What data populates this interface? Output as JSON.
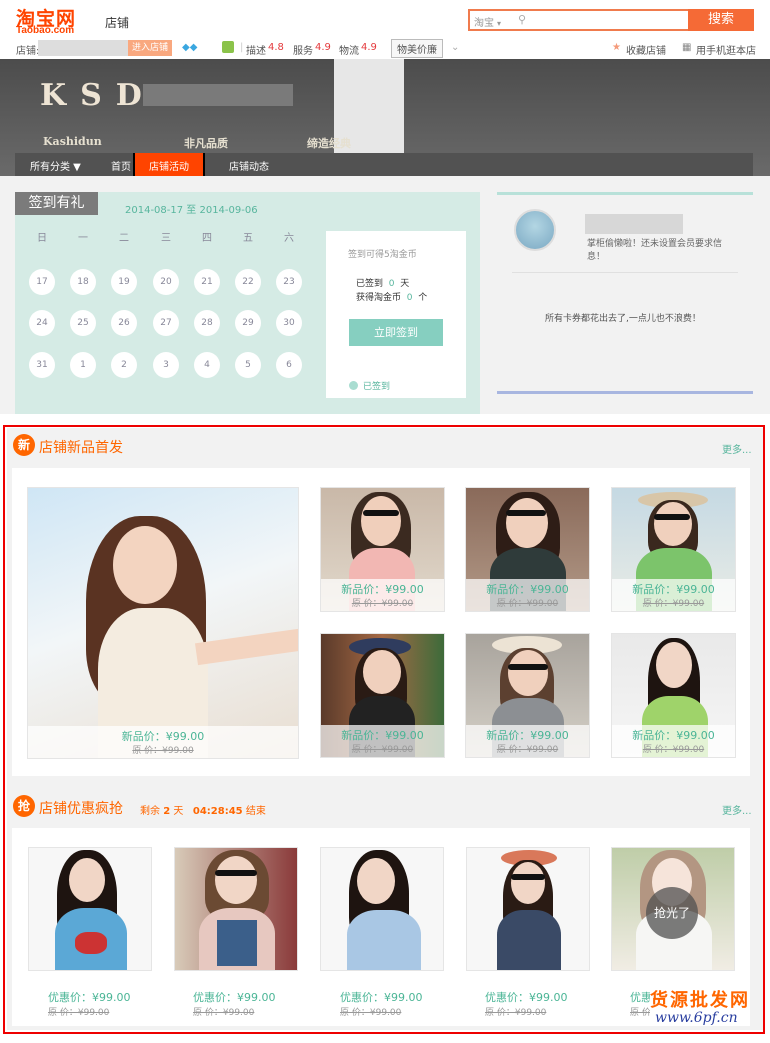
{
  "header": {
    "logo_cn": "淘宝网",
    "logo_en": "Taobao.com",
    "shop_tab": "店铺",
    "search_scope": "淘宝",
    "search_button": "搜索"
  },
  "infobar": {
    "shop_label": "店铺:",
    "enter_shop": "进入店铺",
    "desc_label": "描述",
    "desc_score": "4.8",
    "service_label": "服务",
    "service_score": "4.9",
    "logistics_label": "物流",
    "logistics_score": "4.9",
    "value_button": "物美价廉",
    "favorite": "收藏店铺",
    "mobile": "用手机逛本店"
  },
  "banner": {
    "brand": "KSD",
    "tag1": "Kashidun",
    "tag2": "非凡品质",
    "tag3": "缔造经典"
  },
  "nav": {
    "items": [
      "所有分类 ▼",
      "首页",
      "店铺活动",
      "店铺动态"
    ]
  },
  "checkin": {
    "title": "签到有礼",
    "date_range": "2014-08-17 至 2014-09-06",
    "weekdays": [
      "日",
      "一",
      "二",
      "三",
      "四",
      "五",
      "六"
    ],
    "days": [
      "17",
      "18",
      "19",
      "20",
      "21",
      "22",
      "23",
      "24",
      "25",
      "26",
      "27",
      "28",
      "29",
      "30",
      "31",
      "1",
      "2",
      "3",
      "4",
      "5",
      "6"
    ],
    "reward_text": "签到可得5淘金币",
    "signed_label": "已签到",
    "signed_count": "0",
    "signed_unit": "天",
    "earned_label": "获得淘金币",
    "earned_count": "0",
    "earned_unit": "个",
    "sign_button": "立即签到",
    "legend": "已签到"
  },
  "member": {
    "message": "掌柜偷懒啦！还未设置会员要求信息！",
    "coupon": "所有卡券都花出去了,一点儿也不浪费！"
  },
  "new_section": {
    "icon": "新",
    "title": "店铺新品首发",
    "more": "更多...",
    "products": [
      {
        "price": "新品价：¥99.00",
        "orig": "原  价：¥99.00"
      },
      {
        "price": "新品价：¥99.00",
        "orig": "原  价：¥99.00"
      },
      {
        "price": "新品价：¥99.00",
        "orig": "原  价：¥99.00"
      },
      {
        "price": "新品价：¥99.00",
        "orig": "原  价：¥99.00"
      },
      {
        "price": "新品价：¥99.00",
        "orig": "原  价：¥99.00"
      },
      {
        "price": "新品价：¥99.00",
        "orig": "原  价：¥99.00"
      },
      {
        "price": "新品价：¥99.00",
        "orig": "原  价：¥99.00"
      }
    ]
  },
  "deal_section": {
    "icon": "抢",
    "title": "店铺优惠疯抢",
    "remain_label": "剩余",
    "remain_days": "2",
    "days_unit": "天",
    "remain_time": "04:28:45",
    "end_label": "结束",
    "more": "更多...",
    "sold_out": "抢光了",
    "products": [
      {
        "price": "优惠价：¥99.00",
        "orig": "原  价：¥99.00"
      },
      {
        "price": "优惠价：¥99.00",
        "orig": "原  价：¥99.00"
      },
      {
        "price": "优惠价：¥99.00",
        "orig": "原  价：¥99.00"
      },
      {
        "price": "优惠价：¥99.00",
        "orig": "原  价：¥99.00"
      },
      {
        "price": "优惠价：¥99.00",
        "orig": "原  价：¥99.00"
      }
    ]
  },
  "watermark": {
    "line1": "货源批发网",
    "line2": "www.6pf.cn"
  }
}
